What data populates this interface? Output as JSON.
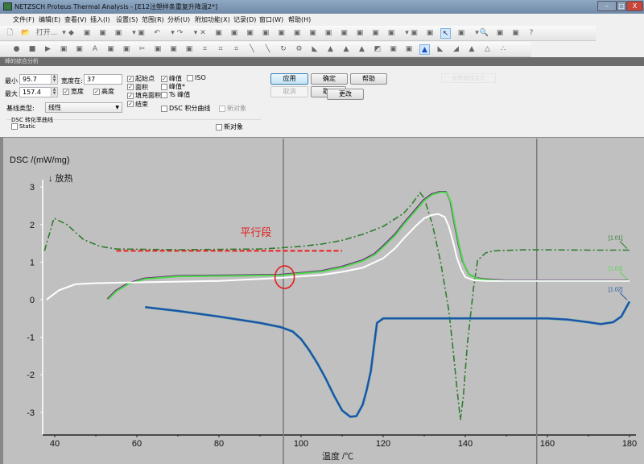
{
  "window": {
    "title": "NETZSCH Proteus Thermal Analysis - [E12注塑样条重复升降温2*]",
    "min": "–",
    "max": "□",
    "close": "X"
  },
  "menu": [
    "文件(F)",
    "编辑(E)",
    "查看(V)",
    "插入(I)",
    "设置(S)",
    "范围(R)",
    "分析(U)",
    "附加功能(X)",
    "记录(D)",
    "窗口(W)",
    "帮助(H)"
  ],
  "toolbar1": {
    "open_label": "打开...",
    "icons": [
      "new-file",
      "open",
      "dropdown",
      "save",
      "undo-range",
      "delete",
      "import",
      "dropdown",
      "export",
      "undo",
      "dropdown",
      "redo",
      "dropdown",
      "cut",
      "copy-curve",
      "curve-a",
      "curve-b",
      "curve-c",
      "grid",
      "curve-d",
      "curve-e",
      "chart",
      "zoom-fit",
      "move",
      "align",
      "scale",
      "dropdown",
      "table",
      "window",
      "pointer",
      "print",
      "dropdown",
      "zoom",
      "line",
      "frame",
      "help"
    ]
  },
  "toolbar2": {
    "icons": [
      "record",
      "stop",
      "play",
      "img1",
      "img2",
      "text",
      "font",
      "note",
      "scissors",
      "copy",
      "paste",
      "brush",
      "frame1",
      "frame2",
      "frame3",
      "line1",
      "line2",
      "refresh",
      "gear",
      "baseline",
      "peak1",
      "peak2",
      "peak3",
      "peak4",
      "deriv1",
      "deriv2",
      "peak-analysis",
      "peak5",
      "step",
      "peak6",
      "peak7",
      "dots"
    ]
  },
  "panel": {
    "title": "峰的综合分析",
    "min_label": "最小",
    "min_value": "95.7",
    "max_label": "最大",
    "max_value": "157.4",
    "width_at_label": "宽度在:",
    "width_at_value": "37",
    "width_cb": {
      "label": "宽度",
      "checked": true
    },
    "height_cb": {
      "label": "高度",
      "checked": true
    },
    "baseline_label": "基线类型:",
    "baseline_value": "线性",
    "checks_col1": [
      {
        "label": "起始点",
        "checked": true
      },
      {
        "label": "面积",
        "checked": true
      },
      {
        "label": "填充面积",
        "checked": true
      },
      {
        "label": "结束",
        "checked": true
      }
    ],
    "checks_col2": [
      {
        "label": "峰值",
        "checked": true
      },
      {
        "label": "峰值*",
        "checked": false
      },
      {
        "label": "Ts 峰值",
        "checked": false
      }
    ],
    "iso": {
      "label": "ISO",
      "checked": false
    },
    "dsc_integral": {
      "label": "DSC 积分曲线",
      "checked": false
    },
    "new_object_1": {
      "label": "新对象",
      "checked": false
    },
    "conversion_group": "DSC 转化率曲线",
    "static": {
      "label": "Static",
      "checked": false
    },
    "new_object_2": {
      "label": "新对象",
      "checked": false
    },
    "buttons": {
      "apply": "应用",
      "ok": "确定",
      "help": "帮助",
      "cancel": "取消",
      "hidden": "取",
      "change": "更改"
    },
    "ghost": "全峰基线显示"
  },
  "chart_data": {
    "type": "line",
    "ylabel": "DSC /(mW/mg)",
    "exo_label": "↓ 放热",
    "xlabel": "温度 /℃",
    "xlim": [
      37,
      181
    ],
    "ylim": [
      -3.6,
      3.3
    ],
    "xticks": [
      40,
      60,
      80,
      100,
      120,
      140,
      160,
      180
    ],
    "yticks": [
      3,
      2,
      1,
      0,
      -1,
      -2,
      -3
    ],
    "markers": [
      95.7,
      157.4
    ],
    "annotation": {
      "text": "平行段",
      "x": 89,
      "y": 1.7,
      "color": "#e02020"
    },
    "parallel_line": {
      "x": [
        55,
        110
      ],
      "y": 1.3,
      "color": "#ee1c1c"
    },
    "circle": {
      "x": 96,
      "y": 0.6
    },
    "series": [
      {
        "name": "[1.01]",
        "color": "#2e7d2e",
        "style": "dashdot",
        "x": [
          37.5,
          39.8,
          43,
          47,
          51,
          55,
          70,
          90,
          95,
          100,
          105,
          110,
          115,
          120,
          125,
          127,
          129,
          130,
          132,
          134,
          136,
          137,
          138,
          138.8,
          139.5,
          140.5,
          142,
          143,
          145,
          147,
          155,
          170,
          180
        ],
        "y": [
          1.3,
          2.17,
          2.0,
          1.6,
          1.42,
          1.35,
          1.33,
          1.35,
          1.38,
          1.42,
          1.48,
          1.58,
          1.74,
          1.95,
          2.3,
          2.55,
          2.85,
          2.7,
          2.0,
          1.0,
          -0.3,
          -1.3,
          -2.4,
          -3.2,
          -2.6,
          -1.2,
          0.3,
          1.05,
          1.25,
          1.3,
          1.33,
          1.32,
          1.32
        ]
      },
      {
        "name": "[1.03]",
        "color": "#4fd84f",
        "style": "solid",
        "x": [
          53,
          55,
          58,
          62,
          70,
          80,
          95,
          105,
          110,
          115,
          118,
          120,
          123,
          125,
          128,
          130,
          132,
          134,
          135.5,
          136.5,
          137.5,
          138.5,
          139.5,
          141,
          143,
          145,
          150,
          165,
          180
        ],
        "y": [
          0,
          0.22,
          0.42,
          0.55,
          0.62,
          0.63,
          0.65,
          0.75,
          0.86,
          1.03,
          1.2,
          1.4,
          1.72,
          2.0,
          2.38,
          2.64,
          2.8,
          2.86,
          2.86,
          2.6,
          2.0,
          1.45,
          1.0,
          0.66,
          0.56,
          0.53,
          0.5,
          0.5,
          0.5
        ]
      },
      {
        "name": "white",
        "color": "#ffffff",
        "style": "solid",
        "x": [
          38,
          41,
          45,
          50,
          55,
          80,
          95,
          105,
          110,
          115,
          120,
          123,
          125,
          128,
          130,
          132,
          133.5,
          135,
          136,
          137,
          138,
          139,
          140,
          142,
          145,
          160,
          180
        ],
        "y": [
          0,
          0.25,
          0.41,
          0.44,
          0.45,
          0.5,
          0.58,
          0.66,
          0.74,
          0.85,
          1.1,
          1.38,
          1.63,
          1.97,
          2.17,
          2.26,
          2.28,
          2.2,
          1.95,
          1.55,
          1.1,
          0.8,
          0.6,
          0.52,
          0.5,
          0.5,
          0.5
        ]
      },
      {
        "name": "[1.02]",
        "color": "#1f4fa8",
        "style": "solid",
        "x": [
          62,
          70,
          80,
          90,
          95,
          98,
          100,
          102,
          104,
          106,
          108,
          110,
          112,
          113.5,
          115,
          116,
          117,
          117.8,
          118.5,
          120,
          140,
          160,
          165,
          170,
          173,
          176,
          178,
          180
        ],
        "y": [
          -0.2,
          -0.3,
          -0.45,
          -0.62,
          -0.73,
          -0.85,
          -1.05,
          -1.35,
          -1.7,
          -2.1,
          -2.55,
          -2.95,
          -3.12,
          -3.1,
          -2.8,
          -2.4,
          -1.9,
          -1.2,
          -0.62,
          -0.5,
          -0.5,
          -0.5,
          -0.53,
          -0.6,
          -0.65,
          -0.6,
          -0.45,
          -0.05
        ]
      }
    ]
  }
}
